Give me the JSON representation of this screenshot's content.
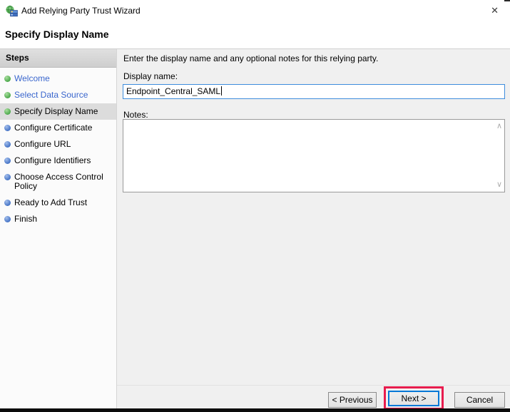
{
  "titlebar": {
    "title": "Add Relying Party Trust Wizard"
  },
  "icons": {
    "close": "✕",
    "chevron_up": "∧",
    "chevron_down": "∨"
  },
  "page": {
    "heading": "Specify Display Name"
  },
  "sidebar": {
    "header": "Steps",
    "steps": [
      {
        "label": "Welcome",
        "status": "done"
      },
      {
        "label": "Select Data Source",
        "status": "done"
      },
      {
        "label": "Specify Display Name",
        "status": "current"
      },
      {
        "label": "Configure Certificate",
        "status": "upcoming"
      },
      {
        "label": "Configure URL",
        "status": "upcoming"
      },
      {
        "label": "Configure Identifiers",
        "status": "upcoming"
      },
      {
        "label": "Choose Access Control Policy",
        "status": "upcoming"
      },
      {
        "label": "Ready to Add Trust",
        "status": "upcoming"
      },
      {
        "label": "Finish",
        "status": "upcoming"
      }
    ]
  },
  "content": {
    "intro": "Enter the display name and any optional notes for this relying party.",
    "display_name": {
      "label": "Display name:",
      "value": "Endpoint_Central_SAML"
    },
    "notes": {
      "label": "Notes:",
      "value": ""
    }
  },
  "buttons": {
    "previous": "< Previous",
    "next": "Next >",
    "cancel": "Cancel"
  },
  "colors": {
    "link_blue": "#3a66cd",
    "dot_done_green": "#46a546",
    "dot_upcoming_blue": "#3f6fc4",
    "focused_input_border": "#3e8ddd",
    "default_button_border": "#0078d7",
    "annotation_red": "#e81c4e",
    "current_step_bg": "#dcdcdc"
  }
}
